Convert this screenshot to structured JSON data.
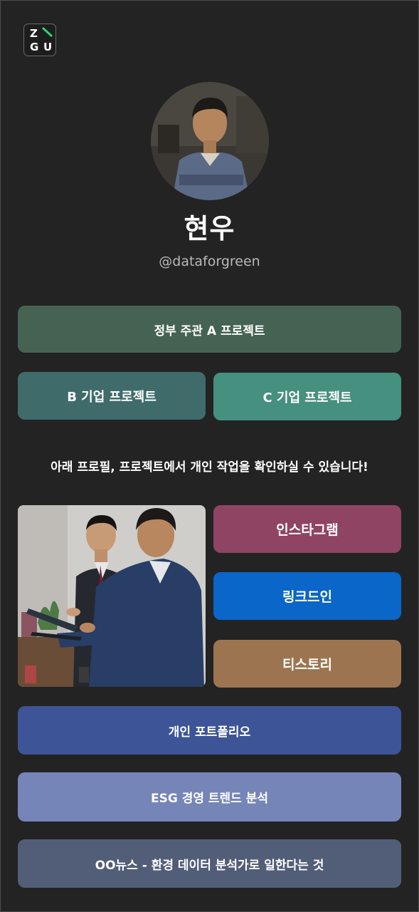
{
  "logo": {
    "letters": [
      "Z",
      "G",
      "U"
    ]
  },
  "profile": {
    "name": "현우",
    "handle": "@dataforgreen"
  },
  "project_buttons": {
    "gov_a": "정부 주관 A 프로젝트",
    "corp_b": "B 기업 프로젝트",
    "corp_c": "C 기업 프로젝트"
  },
  "notice": "아래 프로필, 프로젝트에서 개인 작업을 확인하실 수 있습니다!",
  "social_buttons": {
    "instagram": "인스타그램",
    "linkedin": "링크드인",
    "tistory": "티스토리"
  },
  "link_buttons": {
    "portfolio": "개인 포트폴리오",
    "esg": "ESG 경영 트렌드 분석",
    "news": "OO뉴스 - 환경 데이터 분석가로 일한다는 것"
  },
  "colors": {
    "background": "#232323",
    "gov_a": "#456352",
    "corp_b": "#3f6b6b",
    "corp_c": "#45907e",
    "instagram": "#8f4463",
    "linkedin": "#0a66c8",
    "tistory": "#9c7550",
    "portfolio": "#3d5496",
    "esg": "#7585b8",
    "news": "#525d78"
  }
}
